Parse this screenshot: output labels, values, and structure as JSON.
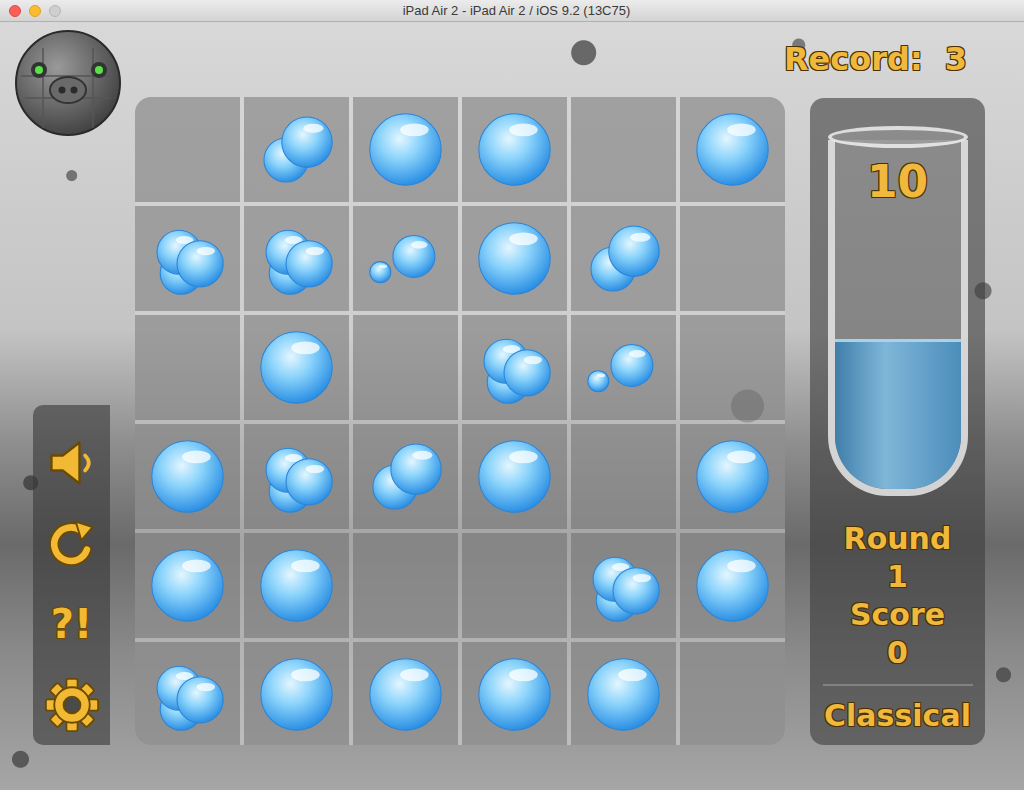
{
  "window": {
    "title": "iPad Air 2 - iPad Air 2 / iOS 9.2 (13C75)"
  },
  "record": {
    "label": "Record:",
    "value": "3"
  },
  "grid": {
    "rows": [
      [
        {
          "kind": "empty"
        },
        {
          "kind": "double"
        },
        {
          "kind": "big"
        },
        {
          "kind": "big"
        },
        {
          "kind": "empty"
        },
        {
          "kind": "big"
        }
      ],
      [
        {
          "kind": "cluster"
        },
        {
          "kind": "cluster"
        },
        {
          "kind": "small"
        },
        {
          "kind": "big"
        },
        {
          "kind": "double"
        },
        {
          "kind": "empty"
        }
      ],
      [
        {
          "kind": "empty"
        },
        {
          "kind": "big"
        },
        {
          "kind": "empty"
        },
        {
          "kind": "cluster"
        },
        {
          "kind": "small"
        },
        {
          "kind": "empty"
        }
      ],
      [
        {
          "kind": "big"
        },
        {
          "kind": "cluster"
        },
        {
          "kind": "double"
        },
        {
          "kind": "big"
        },
        {
          "kind": "empty"
        },
        {
          "kind": "big"
        }
      ],
      [
        {
          "kind": "big"
        },
        {
          "kind": "big"
        },
        {
          "kind": "empty"
        },
        {
          "kind": "empty"
        },
        {
          "kind": "cluster"
        },
        {
          "kind": "big"
        }
      ],
      [
        {
          "kind": "cluster"
        },
        {
          "kind": "big"
        },
        {
          "kind": "big"
        },
        {
          "kind": "big"
        },
        {
          "kind": "big"
        },
        {
          "kind": "empty"
        }
      ]
    ]
  },
  "tube": {
    "count": "10",
    "level": 0.42
  },
  "stats": [
    {
      "label": "Round",
      "value": "1"
    },
    {
      "label": "Score",
      "value": "0"
    }
  ],
  "mode": "Classical",
  "toolbar": [
    {
      "kind": "sound"
    },
    {
      "kind": "restart"
    },
    {
      "kind": "help",
      "text": "?!"
    },
    {
      "kind": "settings"
    }
  ]
}
